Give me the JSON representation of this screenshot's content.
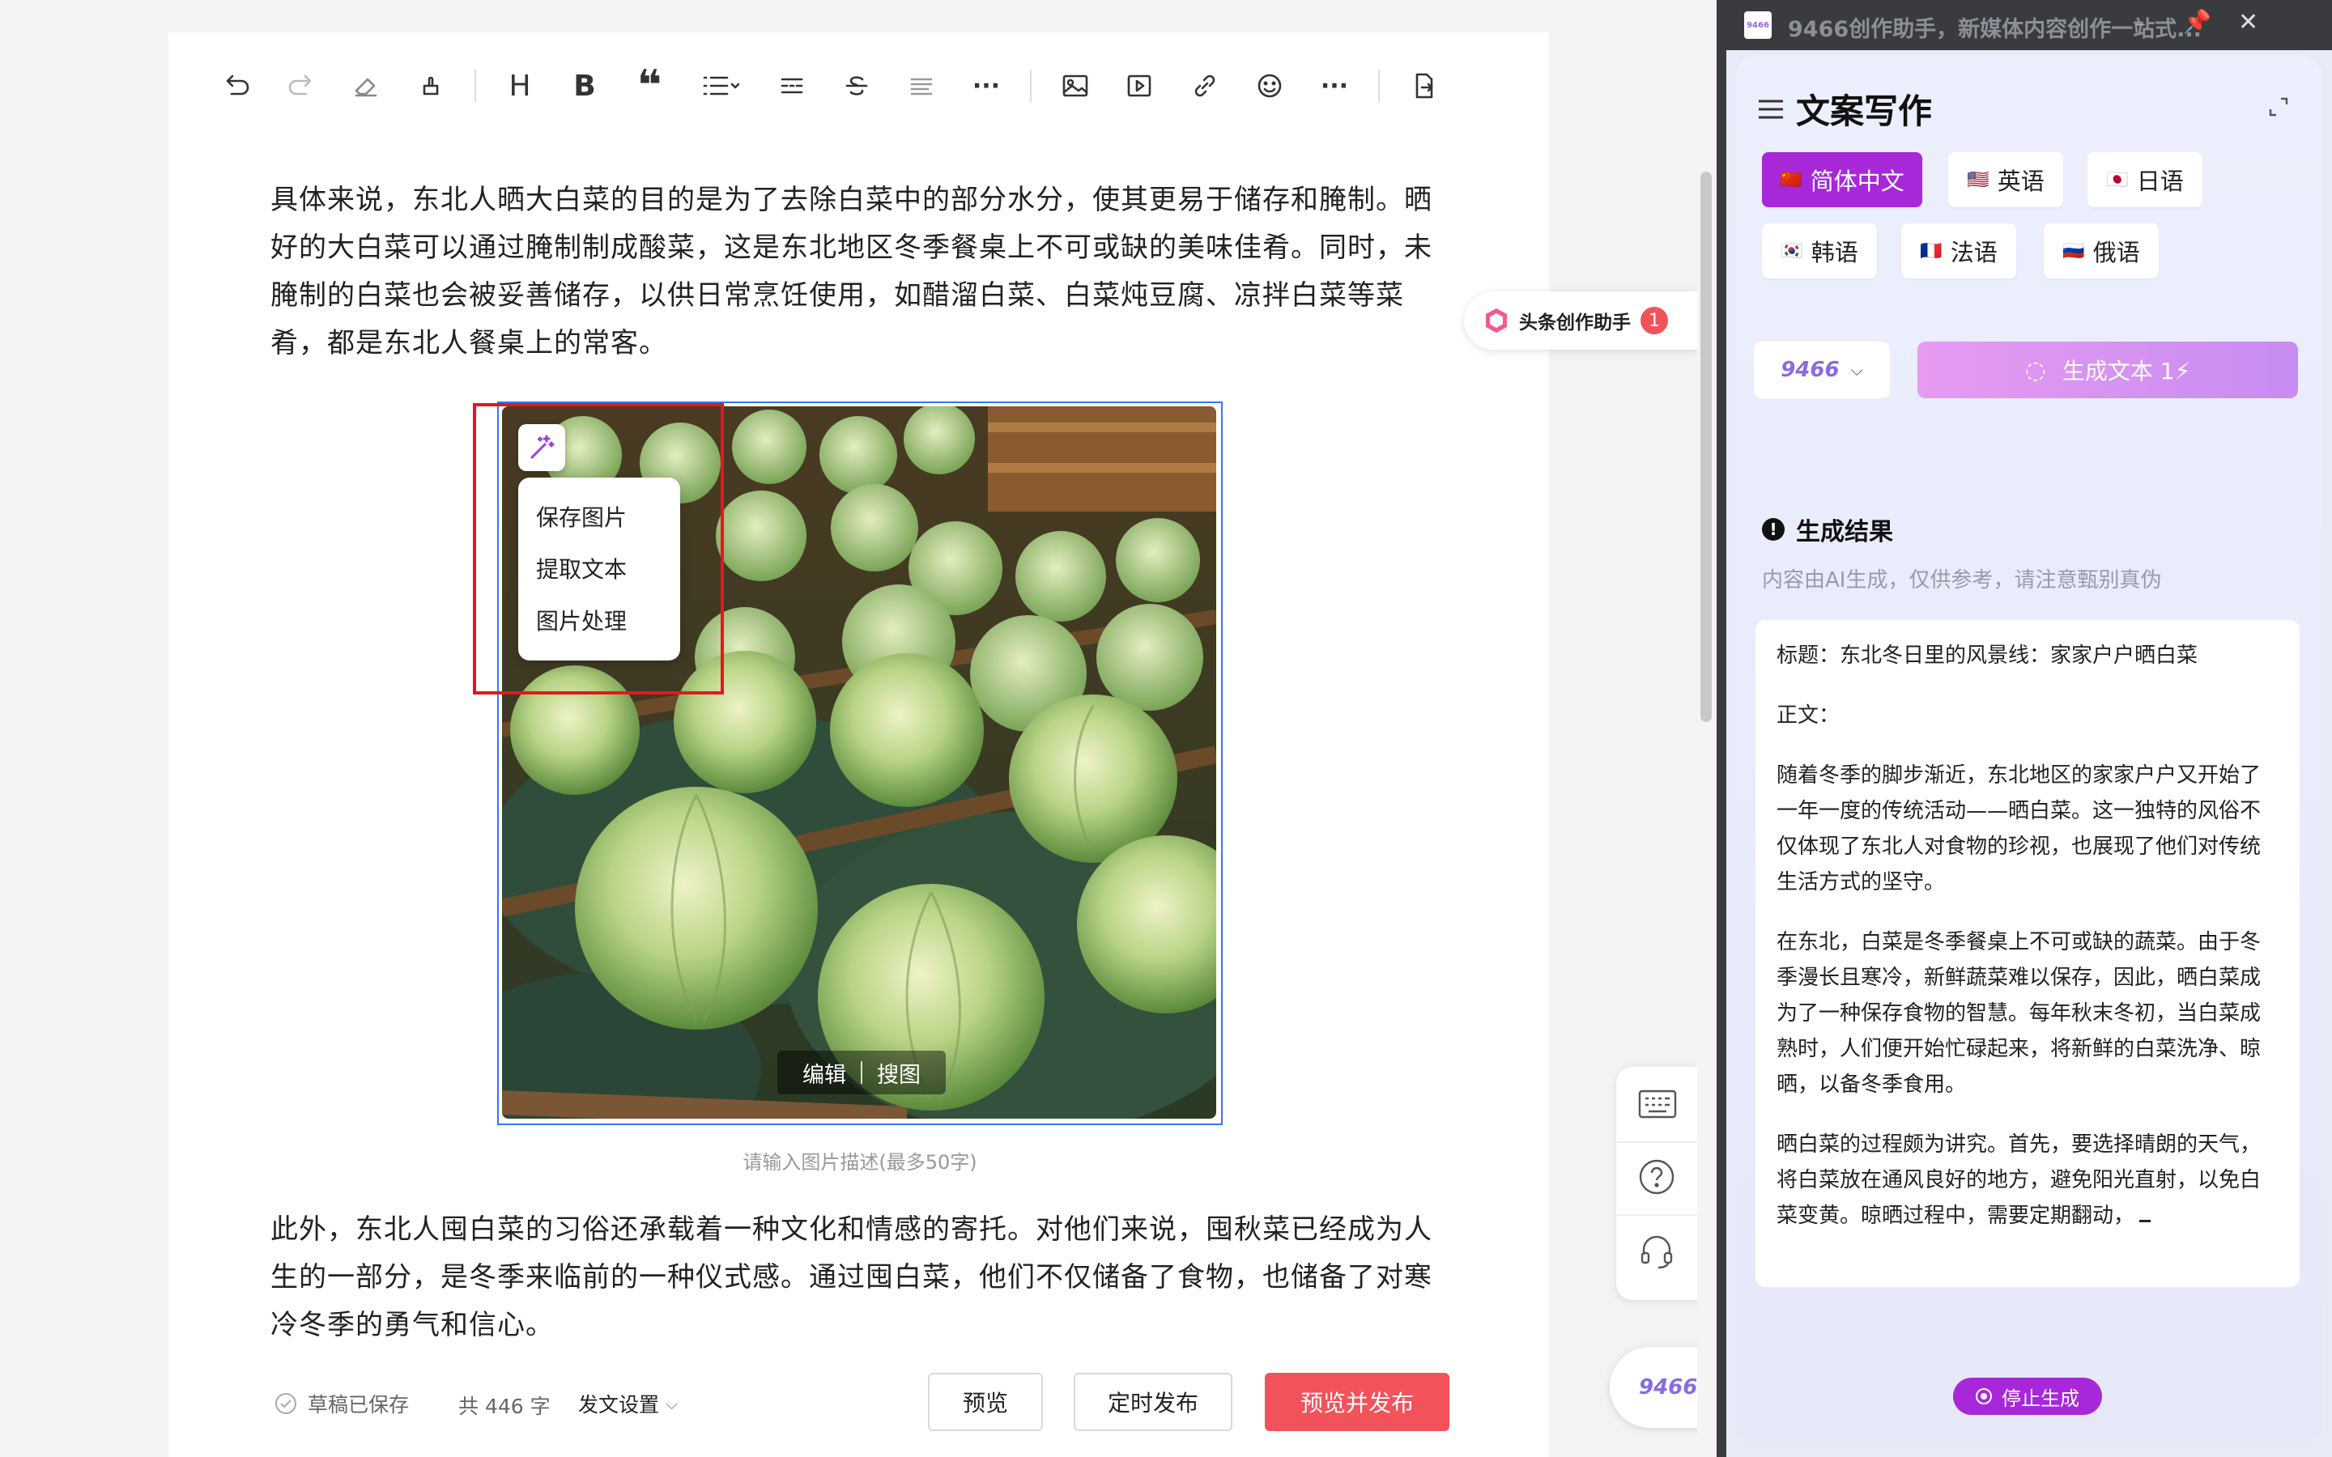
{
  "editor": {
    "paragraph1": "具体来说，东北人晒大白菜的目的是为了去除白菜中的部分水分，使其更易于储存和腌制。晒好的大白菜可以通过腌制制成酸菜，这是东北地区冬季餐桌上不可或缺的美味佳肴。同时，未腌制的白菜也会被妥善储存，以供日常烹饪使用，如醋溜白菜、白菜炖豆腐、凉拌白菜等菜肴，都是东北人餐桌上的常客。",
    "paragraph2": "此外，东北人囤白菜的习俗还承载着一种文化和情感的寄托。对他们来说，囤秋菜已经成为人生的一部分，是冬季来临前的一种仪式感。通过囤白菜，他们不仅储备了食物，也储备了对寒冷冬季的勇气和信心。",
    "image_caption_placeholder": "请输入图片描述(最多50字)",
    "image_context_menu": [
      "保存图片",
      "提取文本",
      "图片处理"
    ],
    "image_bar": {
      "edit": "编辑",
      "search": "搜图"
    }
  },
  "toolbar": {
    "heading": "H",
    "bold": "B"
  },
  "footer": {
    "draft_status": "草稿已保存",
    "word_count": "共 446 字",
    "publish_settings": "发文设置",
    "preview": "预览",
    "scheduled_publish": "定时发布",
    "preview_and_publish": "预览并发布"
  },
  "float_badge": {
    "label": "头条创作助手",
    "count": "1"
  },
  "panel": {
    "window_title": "9466创作助手，新媒体内容创作一站式...",
    "title": "文案写作",
    "languages": [
      {
        "flag": "🇨🇳",
        "label": "简体中文",
        "active": true
      },
      {
        "flag": "🇺🇸",
        "label": "英语"
      },
      {
        "flag": "🇯🇵",
        "label": "日语"
      },
      {
        "flag": "🇰🇷",
        "label": "韩语"
      },
      {
        "flag": "🇫🇷",
        "label": "法语"
      },
      {
        "flag": "🇷🇺",
        "label": "俄语"
      }
    ],
    "model_select": "9466",
    "generate_button": "生成文本 1⚡",
    "result_title": "生成结果",
    "disclaimer": "内容由AI生成，仅供参考，请注意甄别真伪",
    "result": {
      "headline": "标题：东北冬日里的风景线：家家户户晒白菜",
      "body_label": "正文：",
      "p1": "随着冬季的脚步渐近，东北地区的家家户户又开始了一年一度的传统活动——晒白菜。这一独特的风俗不仅体现了东北人对食物的珍视，也展现了他们对传统生活方式的坚守。",
      "p2": "在东北，白菜是冬季餐桌上不可或缺的蔬菜。由于冬季漫长且寒冷，新鲜蔬菜难以保存，因此，晒白菜成为了一种保存食物的智慧。每年秋末冬初，当白菜成熟时，人们便开始忙碌起来，将新鲜的白菜洗净、晾晒，以备冬季食用。",
      "p3": "晒白菜的过程颇为讲究。首先，要选择晴朗的天气，将白菜放在通风良好的地方，避免阳光直射，以免白菜变黄。晾晒过程中，需要定期翻动，"
    },
    "stop_button": "停止生成",
    "brand_badge": "9466"
  },
  "colors": {
    "accent_purple": "#a728d9",
    "publish_red": "#f2525a",
    "selection_blue": "#2f7af3",
    "highlight_red": "#e3181f"
  }
}
